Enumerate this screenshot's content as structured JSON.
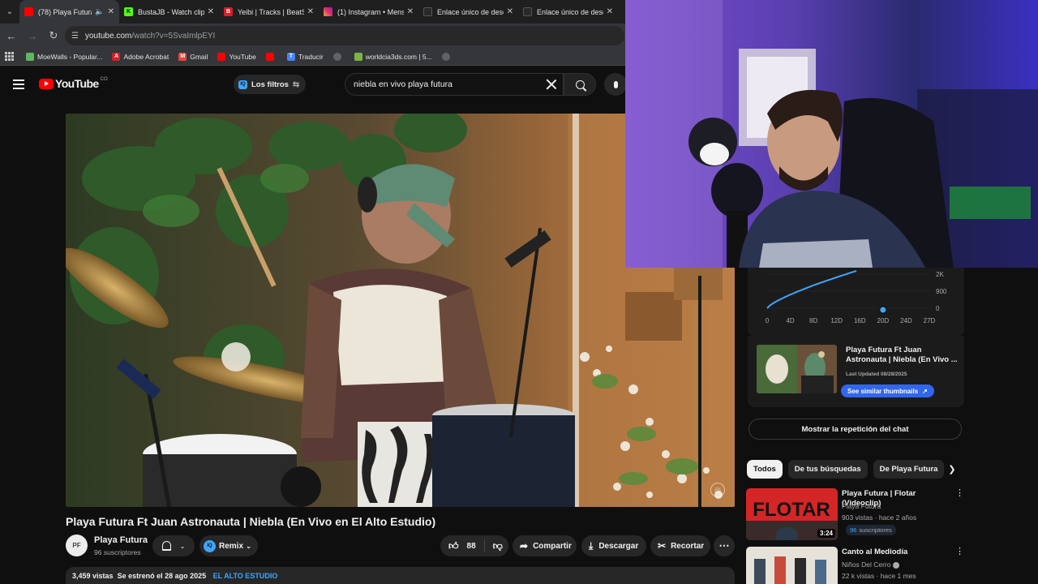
{
  "browser": {
    "tabs": [
      {
        "title": "(78) Playa Futura",
        "favicon_color": "#ff0000",
        "active": true,
        "has_audio": true
      },
      {
        "title": "BustaJB - Watch clips",
        "favicon_color": "#53fc18",
        "active": false
      },
      {
        "title": "Yeibi | Tracks | BeatSt",
        "favicon_color": "#d61f26",
        "active": false
      },
      {
        "title": "(1) Instagram • Mensa",
        "favicon_color": "#e1306c",
        "active": false
      },
      {
        "title": "Enlace único de desca",
        "favicon_color": "#2a2a2a",
        "active": false
      },
      {
        "title": "Enlace único de desca",
        "favicon_color": "#2a2a2a",
        "active": false
      }
    ],
    "url_host": "youtube.com",
    "url_path": "/watch?v=5SvaImlpEYI",
    "bookmarks": [
      {
        "label": "MoeWalls - Popular...",
        "icon_color": "#5cb85c"
      },
      {
        "label": "Adobe Acrobat",
        "icon_color": "#d61f26"
      },
      {
        "label": "Gmail",
        "icon_color": "#ea4335"
      },
      {
        "label": "YouTube",
        "icon_color": "#ff0000"
      },
      {
        "label": "",
        "icon_color": "#ff0000"
      },
      {
        "label": "Traducir",
        "icon_color": "#4285f4"
      },
      {
        "label": "",
        "icon_color": "#9aa0a6"
      },
      {
        "label": "worldcia3ds.com | 5...",
        "icon_color": "#7cb342"
      },
      {
        "label": "",
        "icon_color": "#9aa0a6"
      }
    ]
  },
  "header": {
    "logo_text": "YouTube",
    "country_code": "CO",
    "filters_label": "Los filtros",
    "search_value": "niebla en vivo playa futura"
  },
  "video": {
    "title": "Playa Futura Ft Juan Astronauta | Niebla (En Vivo en El Alto Estudio)",
    "channel_name": "Playa Futura",
    "channel_avatar_text": "PF",
    "subscribers": "96 suscriptores",
    "remix_label": "Remix",
    "likes": "88",
    "share_label": "Compartir",
    "download_label": "Descargar",
    "clip_label": "Recortar",
    "views": "3,459 vistas",
    "premiered": "Se estrenó el 28 ago 2025",
    "tag": "EL ALTO ESTUDIO"
  },
  "sidebar": {
    "chart_data": {
      "type": "line",
      "x_tick_labels": [
        "0",
        "4D",
        "8D",
        "12D",
        "16D",
        "20D",
        "24D",
        "27D"
      ],
      "y_tick_labels": [
        "2K",
        "900",
        "0"
      ],
      "line_color": "#3ea6ff",
      "current_marker_x_label": "20D"
    },
    "similar": {
      "title": "Playa Futura Ft Juan Astronauta | Niebla (En Vivo ...",
      "last_updated": "Last Updated 08/28/2025",
      "button_label": "See similar thumbnails"
    },
    "chat_replay_label": "Mostrar la repetición del chat",
    "chips": [
      "Todos",
      "De tus búsquedas",
      "De Playa Futura"
    ],
    "recommendations": [
      {
        "title": "Playa Futura | Flotar (Videoclip)",
        "channel": "Playa Futura",
        "meta": "903 vistas · hace 2 años",
        "subs_count": "96",
        "subs_label": "suscriptores",
        "duration": "3:24",
        "thumb_text": "FLOTAR"
      },
      {
        "title": "Canto al Mediodía",
        "channel": "Niños Del Cerro",
        "meta": "22 k vistas · hace 1 mes",
        "verified": true
      }
    ]
  }
}
